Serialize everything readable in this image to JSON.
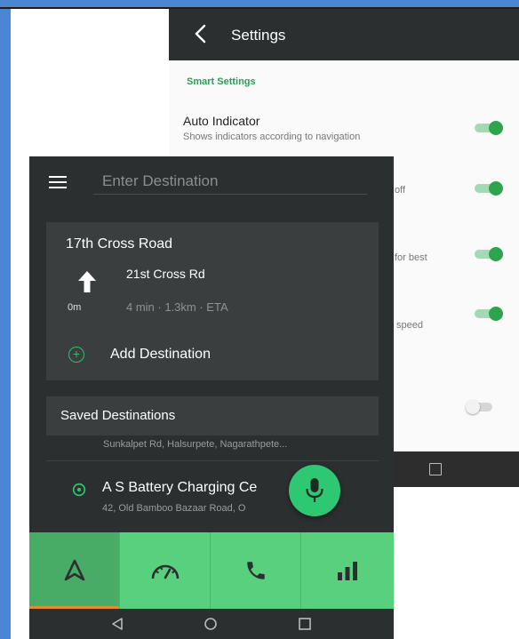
{
  "settings": {
    "title": "Settings",
    "section": "Smart Settings",
    "rows": [
      {
        "title": "Auto Indicator",
        "subtitle": "Shows indicators according to navigation",
        "toggle": "on"
      },
      {
        "title": "",
        "subtitle": "off",
        "toggle": "on"
      },
      {
        "title": "",
        "subtitle": "for best",
        "toggle": "on"
      },
      {
        "title": "",
        "subtitle": "speed",
        "toggle": "on"
      },
      {
        "title": "",
        "subtitle": "",
        "toggle": "off"
      }
    ]
  },
  "app": {
    "search_placeholder": "Enter Destination",
    "route": {
      "title": "17th Cross Road",
      "next_street": "21st Cross Rd",
      "distance": "0m",
      "eta": "4 min · 1.3km · ETA",
      "add_label": "Add Destination"
    },
    "saved": {
      "title": "Saved Destinations",
      "items": [
        {
          "name": "",
          "address": "Sunkalpet Rd, Halsurpete, Nagarathpete..."
        },
        {
          "name": "A S Battery Charging Ce",
          "address": "42, Old Bamboo Bazaar Road, O"
        }
      ]
    },
    "nav_tabs": [
      {
        "icon": "navigation-arrow-icon",
        "active": true
      },
      {
        "icon": "speedometer-icon",
        "active": false
      },
      {
        "icon": "phone-icon",
        "active": false
      },
      {
        "icon": "signal-bars-icon",
        "active": false
      }
    ]
  },
  "colors": {
    "accent_green": "#2fbf69",
    "nav_green": "#59d07e",
    "dark_bg": "#2b2f30",
    "card_bg": "#3a3e3f",
    "frame_blue": "#4a86d4"
  }
}
